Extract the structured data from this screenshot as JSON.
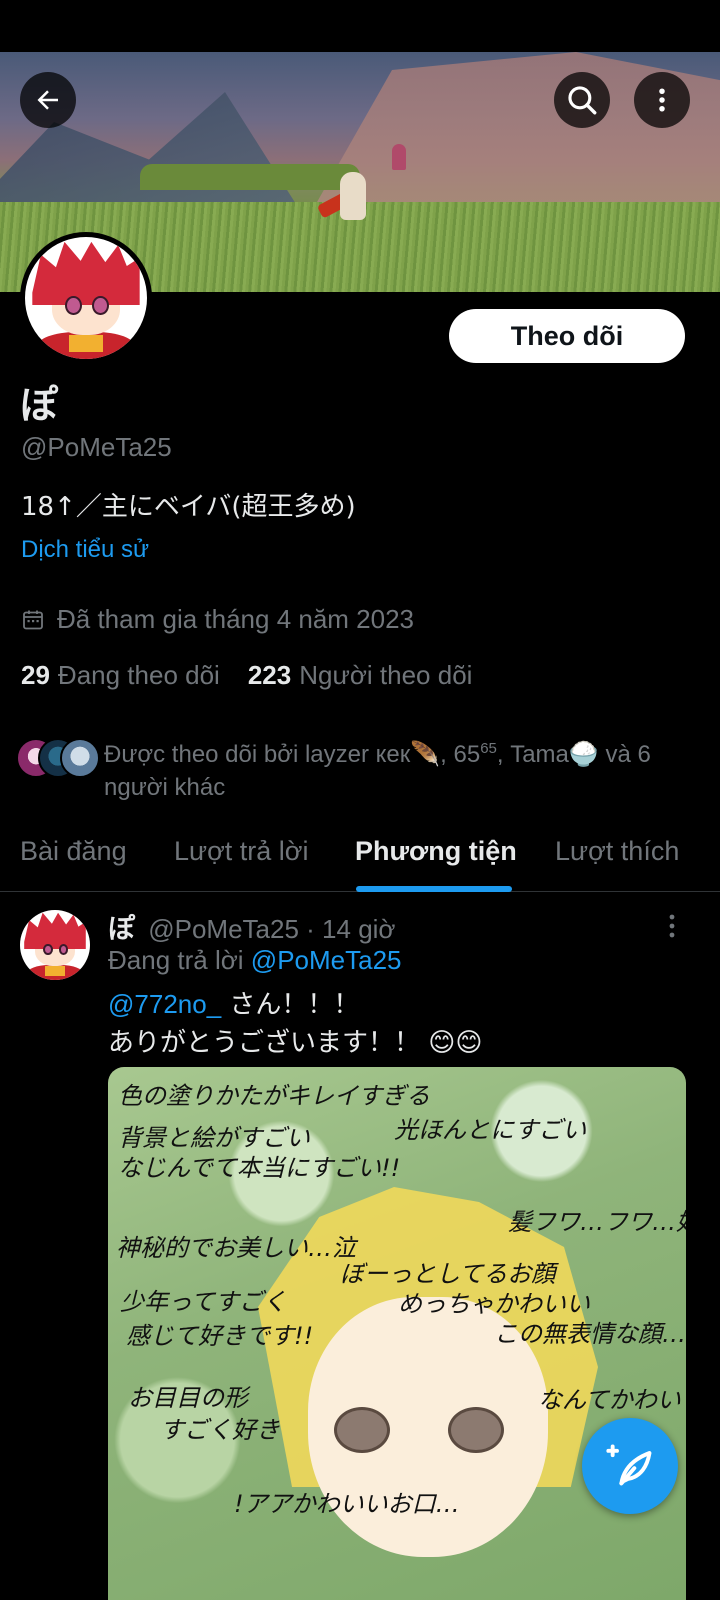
{
  "profile": {
    "display_name": "ぽ",
    "handle": "@PoMeTa25",
    "bio": "18↑／主にベイバ(超王多め)",
    "translate_bio": "Dịch tiểu sử",
    "joined": "Đã tham gia tháng 4 năm 2023",
    "following_count": "29",
    "following_label": "Đang theo dõi",
    "followers_count": "223",
    "followers_label": "Người theo dõi",
    "follow_button": "Theo dõi",
    "followed_by_prefix": "Được theo dõi bởi layzer кек🪶, 65",
    "followed_by_sup": "65",
    "followed_by_suffix": ", Tama🍚 và 6 người khác"
  },
  "tabs": [
    {
      "label": "Bài đăng"
    },
    {
      "label": "Lượt trả lời"
    },
    {
      "label": "Phương tiện",
      "active": true
    },
    {
      "label": "Lượt thích"
    }
  ],
  "post": {
    "author_name": "ぽ",
    "author_handle": "@PoMeTa25",
    "time": "· 14 giờ",
    "replying_prefix": "Đang trả lời",
    "replying_to": "@PoMeTa25",
    "mention": "@772no_",
    "line1_rest": " さん！！！",
    "line2": "ありがとうございます！！ 😊😊",
    "media_notes": [
      "色の塗りかたがキレイすぎる",
      "背景と絵がすごい",
      "なじんでて本当にすごい!!",
      "光ほんとにすごい",
      "神秘的でお美しい…泣",
      "髪フワ…フワ…好",
      "ぼーっとしてるお顔",
      "めっちゃかわいい",
      "少年ってすごく",
      "感じて好きです!!",
      "この無表情な顔…っ!!",
      "お目目の形",
      "すごく好き",
      "なんてかわいさ",
      "!アアかわいいお口…"
    ]
  },
  "icons": {
    "back": "back-arrow-icon",
    "search": "search-icon",
    "more": "more-vertical-icon",
    "calendar": "calendar-icon",
    "compose": "compose-post-icon"
  },
  "colors": {
    "accent": "#1d9bf0",
    "background": "#000000",
    "text_primary": "#e7e9ea",
    "text_secondary": "#71767b"
  }
}
